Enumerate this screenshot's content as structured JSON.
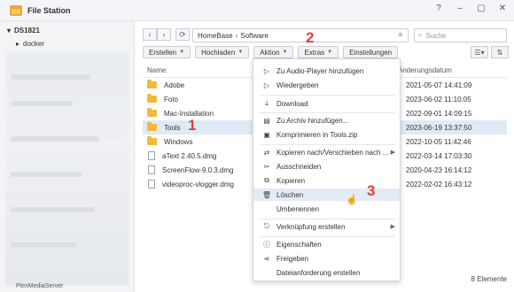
{
  "window": {
    "title": "File Station",
    "controls": [
      "?",
      "–",
      "▢",
      "✕"
    ]
  },
  "sidebar": {
    "root": "DS1821",
    "child": "docker",
    "bottom_item": "PlexMediaServer"
  },
  "nav": {
    "back": "‹",
    "forward": "›",
    "refresh": "⟳",
    "path": [
      "HomeBase",
      "Software"
    ],
    "path_sep": "›",
    "search_placeholder": "Suche"
  },
  "toolbar": {
    "create": "Erstellen",
    "upload": "Hochladen",
    "action": "Aktion",
    "extras": "Extras",
    "settings": "Einstellungen"
  },
  "columns": {
    "name": "Name",
    "date": "Änderungsdatum"
  },
  "files": [
    {
      "name": "Adobe",
      "type": "folder",
      "date": "2021-05-07 14:41:09"
    },
    {
      "name": "Foto",
      "type": "folder",
      "date": "2023-06-02 11:10:05"
    },
    {
      "name": "Mac-Installation",
      "type": "folder",
      "date": "2022-09-01 14:09:15"
    },
    {
      "name": "Tools",
      "type": "folder",
      "date": "2023-06-19 13:37:50",
      "selected": true
    },
    {
      "name": "Windows",
      "type": "folder",
      "date": "2022-10-05 11:42:46"
    },
    {
      "name": "aText 2.40.5.dmg",
      "type": "file",
      "date": "2022-03-14 17:03:30"
    },
    {
      "name": "ScreenFlow-9.0.3.dmg",
      "type": "file",
      "date": "2020-04-23 16:14:12"
    },
    {
      "name": "videoproc-vlogger.dmg",
      "type": "file",
      "date": "2022-02-02 16:43:12"
    }
  ],
  "status": "8 Elemente",
  "context_menu": [
    {
      "icon": "play-outline-icon",
      "glyph": "▷",
      "label": "Zu Audio-Player hinzufügen"
    },
    {
      "icon": "play-icon",
      "glyph": "▷",
      "label": "Wiedergeben"
    },
    {
      "divider": true
    },
    {
      "icon": "download-icon",
      "glyph": "⤓",
      "label": "Download"
    },
    {
      "divider": true
    },
    {
      "icon": "archive-icon",
      "glyph": "▤",
      "label": "Zu Archiv hinzufügen..."
    },
    {
      "icon": "compress-icon",
      "glyph": "▣",
      "label": "Komprimieren in Tools.zip"
    },
    {
      "divider": true
    },
    {
      "icon": "copy-move-icon",
      "glyph": "⇄",
      "label": "Kopieren nach/Verschieben nach ...",
      "submenu": true
    },
    {
      "icon": "cut-icon",
      "glyph": "✂",
      "label": "Ausschneiden"
    },
    {
      "icon": "copy-icon",
      "glyph": "⧉",
      "label": "Kopieren"
    },
    {
      "icon": "trash-icon",
      "glyph": "🗑",
      "label": "Löschen",
      "highlighted": true
    },
    {
      "icon": "",
      "glyph": "",
      "label": "Umbenennen"
    },
    {
      "divider": true
    },
    {
      "icon": "shortcut-icon",
      "glyph": "⎋",
      "label": "Verknüpfung erstellen",
      "submenu": true
    },
    {
      "divider": true
    },
    {
      "icon": "info-icon",
      "glyph": "ⓘ",
      "label": "Eigenschaften"
    },
    {
      "icon": "share-icon",
      "glyph": "⋖",
      "label": "Freigeben"
    },
    {
      "icon": "",
      "glyph": "",
      "label": "Dateianforderung erstellen"
    }
  ],
  "markers": [
    "1",
    "2",
    "3"
  ],
  "colors": {
    "accent": "#e53d3d",
    "folder": "#f5b93a",
    "selection": "#dfeaf7"
  }
}
